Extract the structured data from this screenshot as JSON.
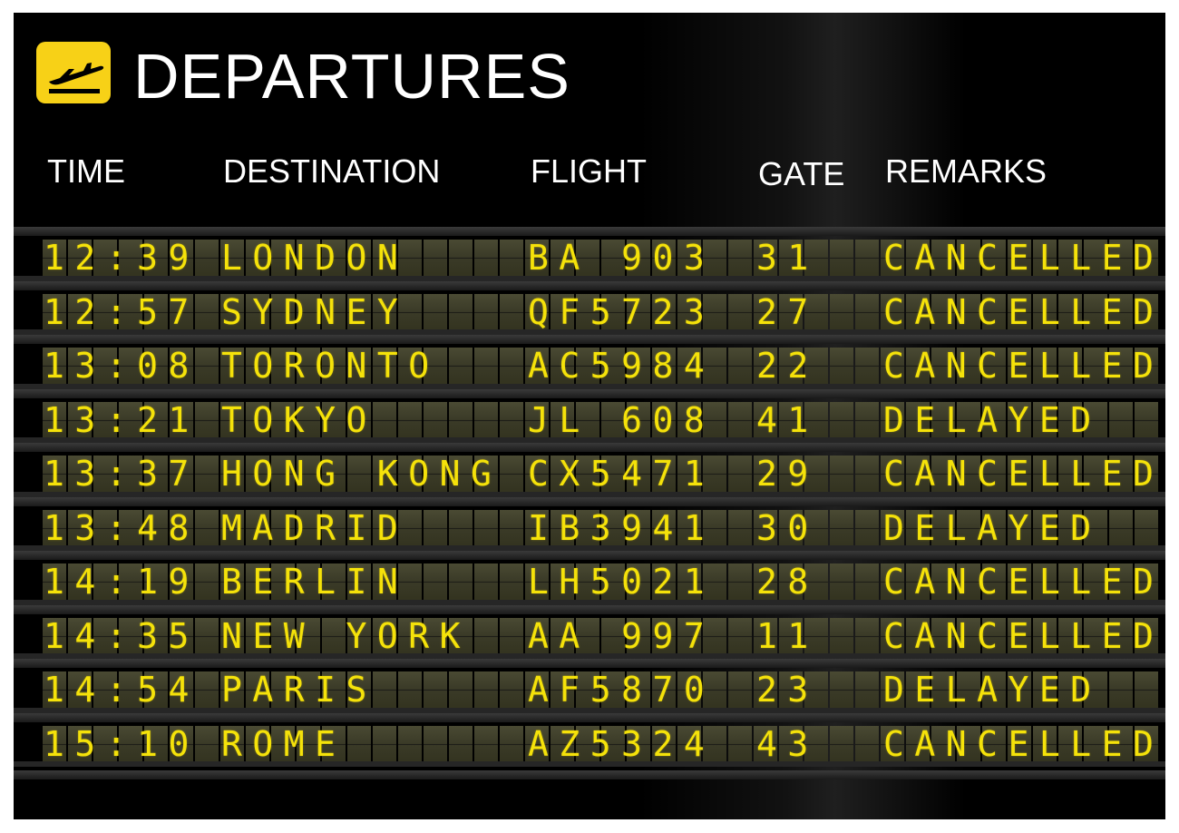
{
  "board": {
    "title": "DEPARTURES",
    "icon": "departure-plane-icon",
    "accent_color": "#f7d117",
    "text_color": "#f5e20a",
    "headers": {
      "time": "TIME",
      "destination": "DESTINATION",
      "flight": "FLIGHT",
      "gate": "GATE",
      "remarks": "REMARKS"
    },
    "rows": [
      {
        "time": "12:39",
        "destination": "LONDON",
        "flight": "BA 903",
        "gate": "31",
        "remarks": "CANCELLED"
      },
      {
        "time": "12:57",
        "destination": "SYDNEY",
        "flight": "QF5723",
        "gate": "27",
        "remarks": "CANCELLED"
      },
      {
        "time": "13:08",
        "destination": "TORONTO",
        "flight": "AC5984",
        "gate": "22",
        "remarks": "CANCELLED"
      },
      {
        "time": "13:21",
        "destination": "TOKYO",
        "flight": "JL 608",
        "gate": "41",
        "remarks": "DELAYED"
      },
      {
        "time": "13:37",
        "destination": "HONG KONG",
        "flight": "CX5471",
        "gate": "29",
        "remarks": "CANCELLED"
      },
      {
        "time": "13:48",
        "destination": "MADRID",
        "flight": "IB3941",
        "gate": "30",
        "remarks": "DELAYED"
      },
      {
        "time": "14:19",
        "destination": "BERLIN",
        "flight": "LH5021",
        "gate": "28",
        "remarks": "CANCELLED"
      },
      {
        "time": "14:35",
        "destination": "NEW YORK",
        "flight": "AA 997",
        "gate": "11",
        "remarks": "CANCELLED"
      },
      {
        "time": "14:54",
        "destination": "PARIS",
        "flight": "AF5870",
        "gate": "23",
        "remarks": "DELAYED"
      },
      {
        "time": "15:10",
        "destination": "ROME",
        "flight": "AZ5324",
        "gate": "43",
        "remarks": "CANCELLED"
      }
    ]
  }
}
